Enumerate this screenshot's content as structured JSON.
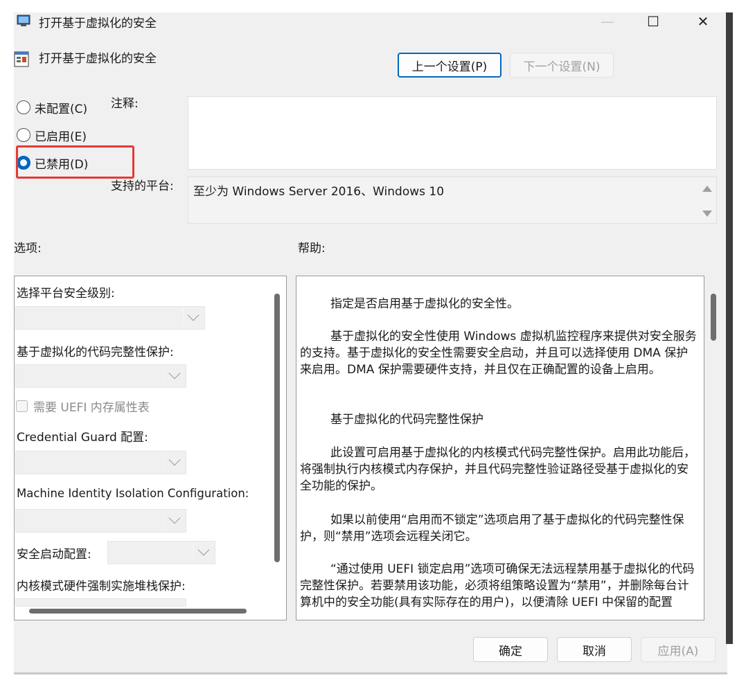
{
  "window": {
    "title": "打开基于虚拟化的安全",
    "header_title": "打开基于虚拟化的安全",
    "minimize": "—",
    "maximize": "☐",
    "close": "✕"
  },
  "nav": {
    "prev_label": "上一个设置(P)",
    "next_label": "下一个设置(N)"
  },
  "state": {
    "not_configured": "未配置(C)",
    "enabled": "已启用(E)",
    "disabled": "已禁用(D)",
    "selected": "disabled"
  },
  "comment": {
    "label": "注释:",
    "value": ""
  },
  "platform": {
    "label": "支持的平台:",
    "value": "至少为 Windows Server 2016、Windows 10"
  },
  "options": {
    "heading": "选项:",
    "items": {
      "platform_level": "选择平台安全级别:",
      "code_integrity": "基于虚拟化的代码完整性保护:",
      "uefi_memory": "需要 UEFI 内存属性表",
      "credential_guard": "Credential Guard 配置:",
      "machine_identity": "Machine Identity Isolation Configuration:",
      "secure_launch": "安全启动配置:",
      "kernel_stack": "内核模式硬件强制实施堆栈保护:"
    }
  },
  "help": {
    "heading": "帮助:",
    "paragraphs": [
      "指定是否启用基于虚拟化的安全性。",
      "基于虚拟化的安全性使用 Windows 虚拟机监控程序来提供对安全服务的支持。基于虚拟化的安全性需要安全启动，并且可以选择使用 DMA 保护来启用。DMA 保护需要硬件支持，并且仅在正确配置的设备上启用。",
      "基于虚拟化的代码完整性保护",
      "此设置可启用基于虚拟化的内核模式代码完整性保护。启用此功能后，将强制执行内核模式内存保护，并且代码完整性验证路径受基于虚拟化的安全功能的保护。",
      "如果以前使用“启用而不锁定”选项启用了基于虚拟化的代码完整性保护，则“禁用”选项会远程关闭它。",
      "“通过使用 UEFI 锁定启用”选项可确保无法远程禁用基于虚拟化的代码完整性保护。若要禁用该功能，必须将组策略设置为“禁用”，并删除每台计算机中的安全功能(具有实际存在的用户)，以便清除 UEFI 中保留的配置"
    ]
  },
  "footer": {
    "ok": "确定",
    "cancel": "取消",
    "apply": "应用(A)"
  },
  "colors": {
    "accent": "#0067c0",
    "highlight_box": "#e53935",
    "window_bg": "#f0f0f0"
  }
}
